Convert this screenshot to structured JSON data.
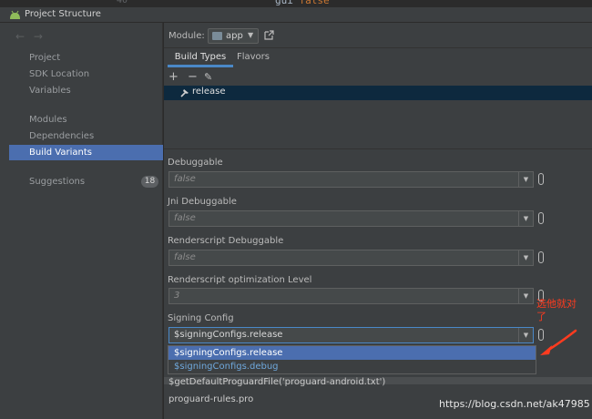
{
  "editor_peek": {
    "code_keyword": "gui",
    "code_value": "false",
    "line_number": "40"
  },
  "window": {
    "title": "Project Structure"
  },
  "sidebar": {
    "nav_back": "←",
    "nav_forward": "→",
    "groups": [
      [
        "Project",
        "SDK Location",
        "Variables"
      ],
      [
        "Modules",
        "Dependencies",
        "Build Variants"
      ]
    ],
    "items": [
      "Project",
      "SDK Location",
      "Variables",
      "Modules",
      "Dependencies",
      "Build Variants"
    ],
    "selected": "Build Variants",
    "suggestions": {
      "label": "Suggestions",
      "count": "18"
    }
  },
  "module": {
    "label": "Module:",
    "value": "app"
  },
  "tabs": [
    {
      "label": "Build Types",
      "active": true
    },
    {
      "label": "Flavors",
      "active": false
    }
  ],
  "toolbar": {
    "add": "+",
    "remove": "−",
    "edit": "✎"
  },
  "build_types": [
    {
      "name": "release",
      "selected": true
    }
  ],
  "fields": [
    {
      "label": "Debuggable",
      "value": "false"
    },
    {
      "label": "Jni Debuggable",
      "value": "false"
    },
    {
      "label": "Renderscript Debuggable",
      "value": "false"
    },
    {
      "label": "Renderscript optimization Level",
      "value": "3"
    },
    {
      "label": "Signing Config",
      "value": "$signingConfigs.release"
    }
  ],
  "signing_options": [
    {
      "label": "$signingConfigs.release",
      "selected": true
    },
    {
      "label": "$signingConfigs.debug",
      "selected": false
    }
  ],
  "proguard": {
    "line1": "$getDefaultProguardFile('proguard-android.txt')",
    "line2": "proguard-rules.pro"
  },
  "annotation": {
    "text": "选他就对了",
    "color": "#ff3b1f"
  },
  "watermark": "https://blog.csdn.net/ak47985",
  "colors": {
    "selection": "#4b6eaf",
    "tab_underline": "#4a88c7",
    "panel": "#3c3f41",
    "list_selection": "#0d293e"
  }
}
